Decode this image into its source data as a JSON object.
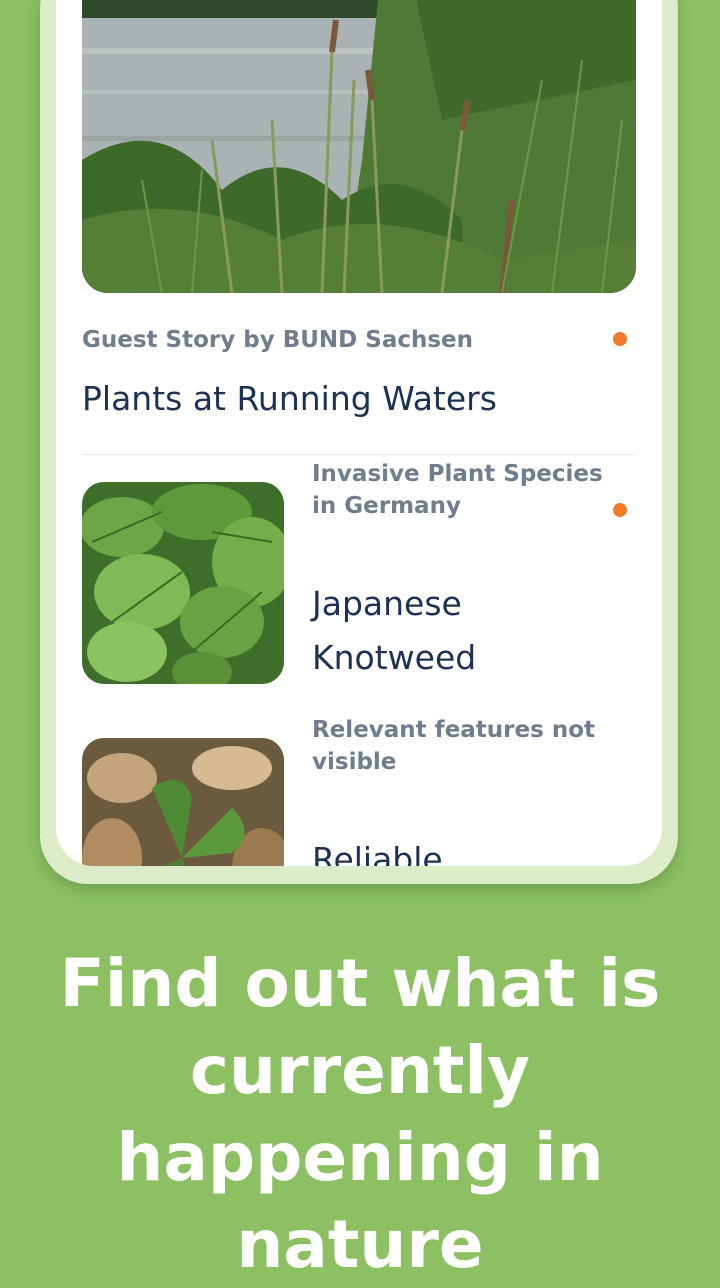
{
  "colors": {
    "background": "#8cc063",
    "card_kicker": "#6f7d8e",
    "card_title": "#1d3253",
    "unread_dot": "#f07b2a",
    "headline": "#ffffff"
  },
  "stories": [
    {
      "kicker": "Guest Story by BUND Sachsen",
      "title": "Plants at Running Waters",
      "unread": true,
      "image_icon": "lake-shore-photo"
    },
    {
      "kicker": "Invasive Plant Species in Germany",
      "title": "Japanese Knotweed",
      "unread": true,
      "image_icon": "knotweed-leaves-photo"
    },
    {
      "kicker": "Relevant features not visible",
      "title": "Reliable",
      "unread": false,
      "image_icon": "clover-leaf-photo"
    }
  ],
  "headline": "Find out what is currently happening in nature"
}
